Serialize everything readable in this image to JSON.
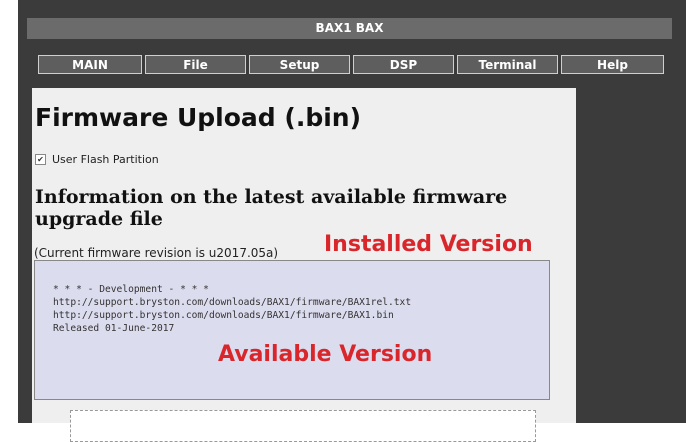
{
  "header": {
    "title": "BAX1 BAX"
  },
  "nav": {
    "items": [
      "MAIN",
      "File",
      "Setup",
      "DSP",
      "Terminal",
      "Help"
    ]
  },
  "page": {
    "title": "Firmware Upload (.bin)",
    "checkbox_label": "User Flash Partition",
    "checkbox_checked": true,
    "section_heading": "Information on the latest available firmware upgrade file",
    "current_revision": "(Current firmware revision is u2017.05a)",
    "info_lines": [
      "* * * - Development - * * *",
      "http://support.bryston.com/downloads/BAX1/firmware/BAX1rel.txt",
      "http://support.bryston.com/downloads/BAX1/firmware/BAX1.bin",
      "Released 01-June-2017"
    ]
  },
  "annotations": {
    "installed": "Installed Version",
    "available": "Available Version",
    "color": "#d8262b"
  }
}
